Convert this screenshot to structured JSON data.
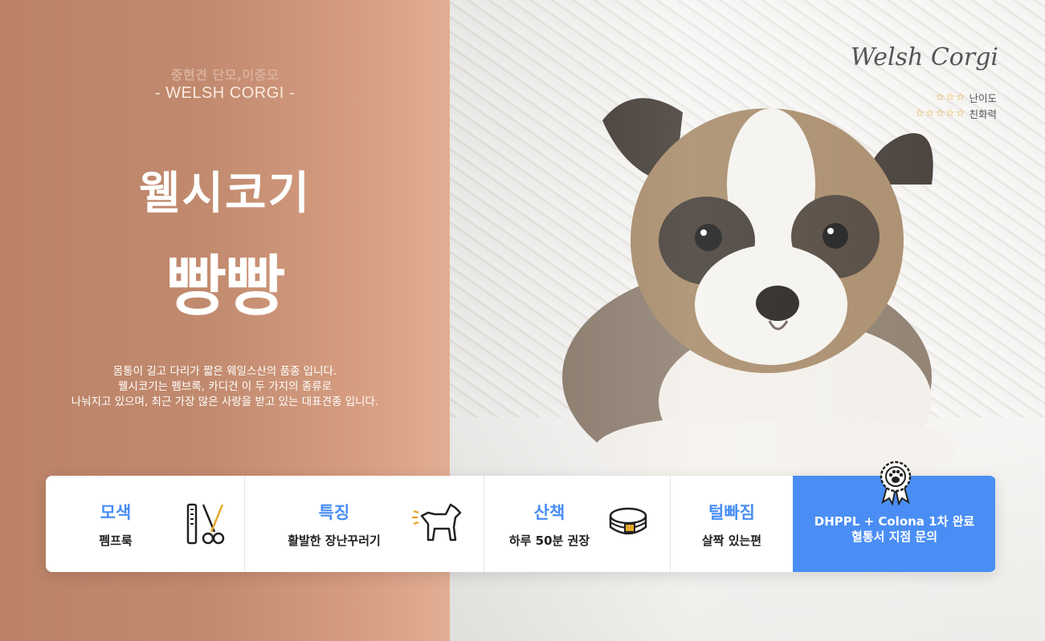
{
  "left": {
    "subtitle_ko": "중현견 단모,이중모",
    "subtitle_en": "- WELSH CORGI -",
    "breed_name": "웰시코기",
    "pet_name": "빵빵",
    "description": [
      "몸통이 길고 다리가 짧은 웨일스산의 품종 입니다.",
      "웰시코기는 펨브록, 카디건 이 두 가지의 종류로",
      "나눠지고 있으며, 최근 가장 많은 사랑을 받고 있는 대표견종 입니다."
    ]
  },
  "photo": {
    "brand": "Welsh Corgi",
    "ratings": [
      {
        "label": "난이도",
        "stars": "☆☆☆",
        "count": 3
      },
      {
        "label": "친화력",
        "stars": "☆☆☆☆☆",
        "count": 5
      }
    ]
  },
  "info": {
    "coat": {
      "label": "모색",
      "value": "펨프룩",
      "icon": "grooming-icon"
    },
    "trait": {
      "label": "특징",
      "value": "활발한 장난꾸러기",
      "icon": "dog-icon"
    },
    "walk": {
      "label": "산책",
      "value": "하루 50분 권장",
      "icon": "collar-icon"
    },
    "shedding": {
      "label": "털빠짐",
      "value": "살짝 있는편"
    },
    "vaccine": {
      "line1": "DHPPL + Colona 1차 완료",
      "line2": "혈통서 지점 문의",
      "icon": "paw-badge-icon"
    }
  },
  "colors": {
    "panel": "#c18a6e",
    "accent": "#4a8ef5",
    "star": "#e4a82a"
  }
}
